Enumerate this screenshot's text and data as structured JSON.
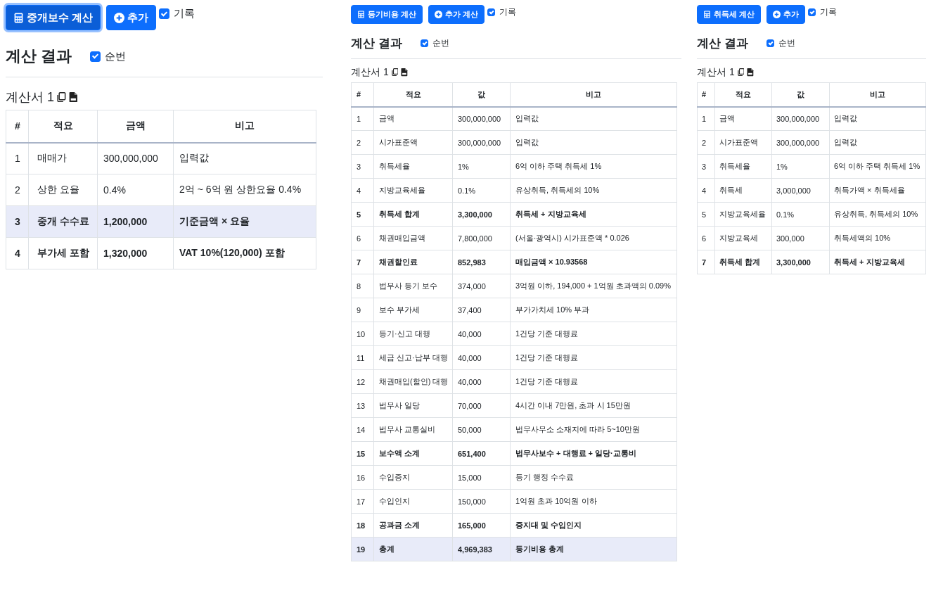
{
  "panels": [
    {
      "buttons": [
        {
          "kind": "calc",
          "label": "중개보수 계산",
          "focused": true
        },
        {
          "kind": "add",
          "label": "추가",
          "focused": false
        }
      ],
      "record": {
        "label": "기록",
        "checked": true
      },
      "heading": "계산 결과",
      "numbering": {
        "label": "순번",
        "checked": true
      },
      "sheet_title": "계산서 1",
      "table": {
        "columns": [
          "#",
          "적요",
          "금액",
          "비고"
        ],
        "rows": [
          {
            "cells": [
              "1",
              "매매가",
              "300,000,000",
              "입력값"
            ],
            "bold": false,
            "highlighted": false
          },
          {
            "cells": [
              "2",
              "상한 요율",
              "0.4%",
              "2억 ~ 6억 원 상한요율 0.4%"
            ],
            "bold": false,
            "highlighted": false
          },
          {
            "cells": [
              "3",
              "중개 수수료",
              "1,200,000",
              "기준금액 × 요율"
            ],
            "bold": true,
            "highlighted": true
          },
          {
            "cells": [
              "4",
              "부가세 포함",
              "1,320,000",
              "VAT 10%(120,000) 포함"
            ],
            "bold": true,
            "highlighted": false
          }
        ]
      }
    },
    {
      "buttons": [
        {
          "kind": "calc",
          "label": "등기비용 계산",
          "focused": false
        },
        {
          "kind": "add",
          "label": "추가 계산",
          "focused": false
        }
      ],
      "record": {
        "label": "기록",
        "checked": true
      },
      "heading": "계산 결과",
      "numbering": {
        "label": "순번",
        "checked": true
      },
      "sheet_title": "계산서 1",
      "table": {
        "columns": [
          "#",
          "적요",
          "값",
          "비고"
        ],
        "rows": [
          {
            "cells": [
              "1",
              "금액",
              "300,000,000",
              "입력값"
            ],
            "bold": false,
            "highlighted": false
          },
          {
            "cells": [
              "2",
              "시가표준액",
              "300,000,000",
              "입력값"
            ],
            "bold": false,
            "highlighted": false
          },
          {
            "cells": [
              "3",
              "취득세율",
              "1%",
              "6억 이하 주택 취득세 1%"
            ],
            "bold": false,
            "highlighted": false
          },
          {
            "cells": [
              "4",
              "지방교육세율",
              "0.1%",
              "유상취득, 취득세의 10%"
            ],
            "bold": false,
            "highlighted": false
          },
          {
            "cells": [
              "5",
              "취득세 합계",
              "3,300,000",
              "취득세 + 지방교육세"
            ],
            "bold": true,
            "highlighted": false
          },
          {
            "cells": [
              "6",
              "채권매입금액",
              "7,800,000",
              "(서울·광역시) 시가표준액 * 0.026"
            ],
            "bold": false,
            "highlighted": false
          },
          {
            "cells": [
              "7",
              "채권할인료",
              "852,983",
              "매입금액 × 10.93568"
            ],
            "bold": true,
            "highlighted": false
          },
          {
            "cells": [
              "8",
              "법무사 등기 보수",
              "374,000",
              "3억원 이하, 194,000 + 1억원 초과액의 0.09%"
            ],
            "bold": false,
            "highlighted": false
          },
          {
            "cells": [
              "9",
              "보수 부가세",
              "37,400",
              "부가가치세 10% 부과"
            ],
            "bold": false,
            "highlighted": false
          },
          {
            "cells": [
              "10",
              "등기·신고 대행",
              "40,000",
              "1건당 기준 대행료"
            ],
            "bold": false,
            "highlighted": false
          },
          {
            "cells": [
              "11",
              "세금 신고·납부 대행",
              "40,000",
              "1건당 기준 대행료"
            ],
            "bold": false,
            "highlighted": false
          },
          {
            "cells": [
              "12",
              "채권매입(할인) 대행",
              "40,000",
              "1건당 기준 대행료"
            ],
            "bold": false,
            "highlighted": false
          },
          {
            "cells": [
              "13",
              "법무사 일당",
              "70,000",
              "4시간 이내 7만원, 초과 시 15만원"
            ],
            "bold": false,
            "highlighted": false
          },
          {
            "cells": [
              "14",
              "법무사 교통실비",
              "50,000",
              "법무사무소 소재지에 따라 5~10만원"
            ],
            "bold": false,
            "highlighted": false
          },
          {
            "cells": [
              "15",
              "보수액 소계",
              "651,400",
              "법무사보수 + 대행료 + 일당·교통비"
            ],
            "bold": true,
            "highlighted": false
          },
          {
            "cells": [
              "16",
              "수입증지",
              "15,000",
              "등기 행정 수수료"
            ],
            "bold": false,
            "highlighted": false
          },
          {
            "cells": [
              "17",
              "수입인지",
              "150,000",
              "1억원 초과 10억원 이하"
            ],
            "bold": false,
            "highlighted": false
          },
          {
            "cells": [
              "18",
              "공과금 소계",
              "165,000",
              "증지대 및 수입인지"
            ],
            "bold": true,
            "highlighted": false
          },
          {
            "cells": [
              "19",
              "총계",
              "4,969,383",
              "등기비용 총계"
            ],
            "bold": true,
            "highlighted": true
          }
        ]
      }
    },
    {
      "buttons": [
        {
          "kind": "calc",
          "label": "취득세 계산",
          "focused": false
        },
        {
          "kind": "add",
          "label": "추가",
          "focused": false
        }
      ],
      "record": {
        "label": "기록",
        "checked": true
      },
      "heading": "계산 결과",
      "numbering": {
        "label": "순번",
        "checked": true
      },
      "sheet_title": "계산서 1",
      "table": {
        "columns": [
          "#",
          "적요",
          "값",
          "비고"
        ],
        "rows": [
          {
            "cells": [
              "1",
              "금액",
              "300,000,000",
              "입력값"
            ],
            "bold": false,
            "highlighted": false
          },
          {
            "cells": [
              "2",
              "시가표준액",
              "300,000,000",
              "입력값"
            ],
            "bold": false,
            "highlighted": false
          },
          {
            "cells": [
              "3",
              "취득세율",
              "1%",
              "6억 이하 주택 취득세 1%"
            ],
            "bold": false,
            "highlighted": false
          },
          {
            "cells": [
              "4",
              "취득세",
              "3,000,000",
              "취득가액 × 취득세율"
            ],
            "bold": false,
            "highlighted": false
          },
          {
            "cells": [
              "5",
              "지방교육세율",
              "0.1%",
              "유상취득, 취득세의 10%"
            ],
            "bold": false,
            "highlighted": false
          },
          {
            "cells": [
              "6",
              "지방교육세",
              "300,000",
              "취득세액의 10%"
            ],
            "bold": false,
            "highlighted": false
          },
          {
            "cells": [
              "7",
              "취득세 합계",
              "3,300,000",
              "취득세 + 지방교육세"
            ],
            "bold": true,
            "highlighted": false
          }
        ]
      }
    }
  ]
}
